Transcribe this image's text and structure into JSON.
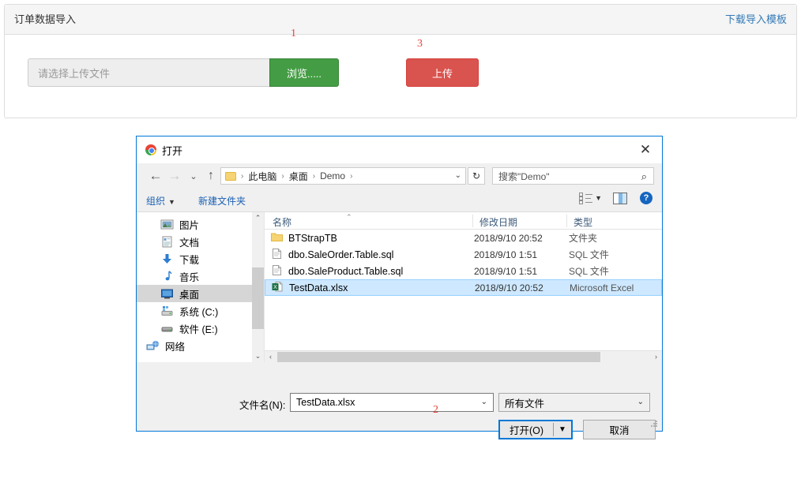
{
  "page": {
    "panel": {
      "title": "订单数据导入",
      "download_link": "下载导入模板",
      "upload_placeholder": "请选择上传文件",
      "browse_label": "浏览.....",
      "upload_label": "上传"
    },
    "annotations": {
      "one": "1",
      "two": "2",
      "three": "3"
    }
  },
  "dialog": {
    "title": "打开",
    "close_label": "✕",
    "nav": {
      "back": "←",
      "forward": "→",
      "history": "⌄",
      "up": "↑",
      "breadcrumbs": [
        "此电脑",
        "桌面",
        "Demo"
      ],
      "separator": "›",
      "dropdown": "⌄",
      "refresh": "↻",
      "search_placeholder": "搜索\"Demo\"",
      "search_icon": "⌕"
    },
    "toolbar": {
      "organize": "组织",
      "organize_caret": "▼",
      "new_folder": "新建文件夹",
      "view_caret": "▼",
      "help": "?"
    },
    "sidebar": {
      "items": [
        {
          "label": "图片",
          "icon": "pictures-icon",
          "selected": false,
          "root": false
        },
        {
          "label": "文档",
          "icon": "documents-icon",
          "selected": false,
          "root": false
        },
        {
          "label": "下载",
          "icon": "downloads-icon",
          "selected": false,
          "root": false
        },
        {
          "label": "音乐",
          "icon": "music-icon",
          "selected": false,
          "root": false
        },
        {
          "label": "桌面",
          "icon": "desktop-icon",
          "selected": true,
          "root": false
        },
        {
          "label": "系统 (C:)",
          "icon": "sysdrive-icon",
          "selected": false,
          "root": false
        },
        {
          "label": "软件 (E:)",
          "icon": "drive-icon",
          "selected": false,
          "root": false
        },
        {
          "label": "网络",
          "icon": "network-icon",
          "selected": false,
          "root": true
        }
      ],
      "scroll_up": "⌃",
      "scroll_down": "⌄"
    },
    "filelist": {
      "columns": [
        "名称",
        "修改日期",
        "类型"
      ],
      "sort_caret": "⌃",
      "rows": [
        {
          "name": "BTStrapTB",
          "date": "2018/9/10 20:52",
          "type": "文件夹",
          "icon": "folder-icon",
          "selected": false
        },
        {
          "name": "dbo.SaleOrder.Table.sql",
          "date": "2018/9/10 1:51",
          "type": "SQL 文件",
          "icon": "file-icon",
          "selected": false
        },
        {
          "name": "dbo.SaleProduct.Table.sql",
          "date": "2018/9/10 1:51",
          "type": "SQL 文件",
          "icon": "file-icon",
          "selected": false
        },
        {
          "name": "TestData.xlsx",
          "date": "2018/9/10 20:52",
          "type": "Microsoft Excel",
          "icon": "excel-icon",
          "selected": true
        }
      ],
      "hscroll_left": "‹",
      "hscroll_right": "›"
    },
    "footer": {
      "filename_label": "文件名(N):",
      "filename_value": "TestData.xlsx",
      "filename_caret": "⌄",
      "filetype_value": "所有文件",
      "filetype_caret": "⌄",
      "open_label": "打开(O)",
      "open_caret": "▼",
      "cancel_label": "取消"
    }
  },
  "colors": {
    "link": "#337ab7",
    "browse_green": "#449d44",
    "upload_red": "#d9534f",
    "annotation_red": "#e8443c",
    "dialog_border": "#0078d7",
    "selection_blue": "#cde8ff"
  }
}
